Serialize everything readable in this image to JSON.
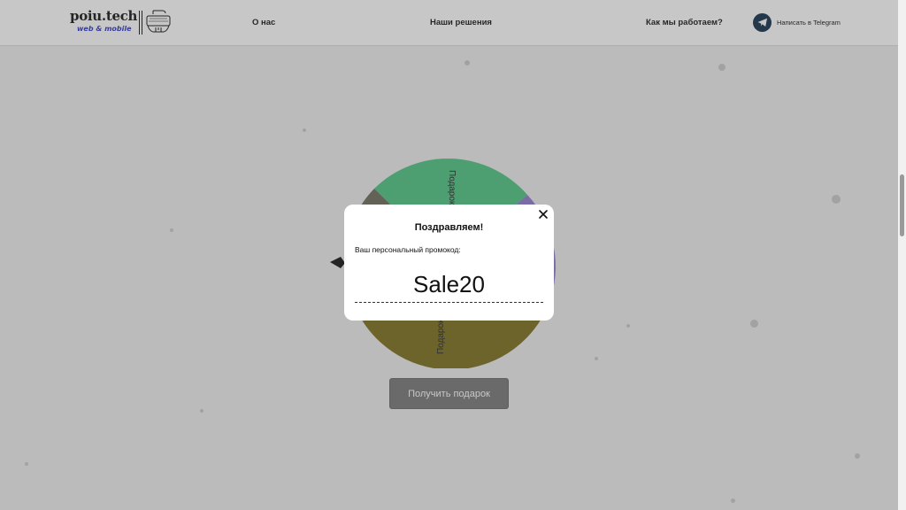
{
  "header": {
    "logo_text": "poiu.tech",
    "logo_subtitle": "web & mobile",
    "nav": [
      {
        "label": "О нас"
      },
      {
        "label": "Наши решения"
      },
      {
        "label": "Как мы работаем?"
      }
    ],
    "telegram": {
      "label": "Написать в Telegram",
      "icon": "telegram-icon"
    }
  },
  "wheel": {
    "segment_label": "Подарок",
    "segment_colors": [
      "#4cc482",
      "#8f79d1",
      "#7b6d1a",
      "#6a6a5a"
    ]
  },
  "gift_button": {
    "label": "Получить подарок"
  },
  "modal": {
    "title": "Поздравляем!",
    "label": "Ваш персональный промокод:",
    "promo_code": "Sale20",
    "close_icon": "close-icon"
  },
  "colors": {
    "brand_blue": "#2b35c9",
    "telegram_dark": "#0f2d4a",
    "overlay": "rgba(80,80,80,0.32)"
  }
}
